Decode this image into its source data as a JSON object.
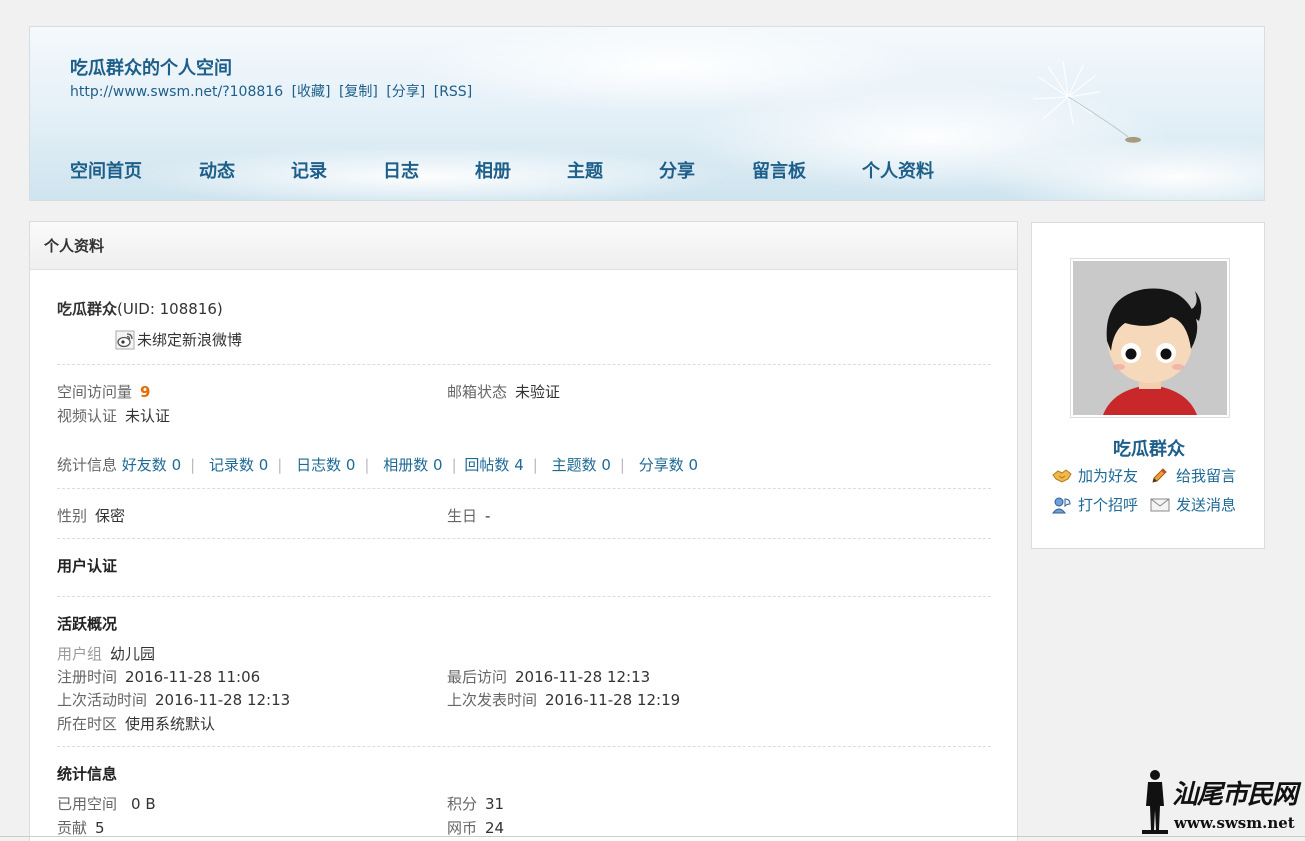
{
  "header": {
    "title": "吃瓜群众的个人空间",
    "url": "http://www.swsm.net/?108816",
    "url_links": [
      "[收藏]",
      "[复制]",
      "[分享]",
      "[RSS]"
    ],
    "nav": [
      "空间首页",
      "动态",
      "记录",
      "日志",
      "相册",
      "主题",
      "分享",
      "留言板",
      "个人资料"
    ]
  },
  "panel": {
    "title": "个人资料",
    "username": "吃瓜群众",
    "uid": "(UID: 108816)",
    "weibo": "未绑定新浪微博",
    "visits_label": "空间访问量",
    "visits_value": "9",
    "email_label": "邮箱状态",
    "email_value": "未验证",
    "video_label": "视频认证",
    "video_value": "未认证",
    "stats_label": "统计信息",
    "stats": [
      "好友数 0",
      "记录数 0",
      "日志数 0",
      "相册数 0",
      "回帖数 4",
      "主题数 0",
      "分享数 0"
    ],
    "gender_label": "性别",
    "gender_value": "保密",
    "birthday_label": "生日",
    "birthday_value": "-",
    "auth_title": "用户认证",
    "active_title": "活跃概况",
    "group_label": "用户组",
    "group_value": "幼儿园",
    "reg_label": "注册时间",
    "reg_value": "2016-11-28 11:06",
    "last_visit_label": "最后访问",
    "last_visit_value": "2016-11-28 12:13",
    "last_active_label": "上次活动时间",
    "last_active_value": "2016-11-28 12:13",
    "last_post_label": "上次发表时间",
    "last_post_value": "2016-11-28 12:19",
    "tz_label": "所在时区",
    "tz_value": "使用系统默认",
    "stat_title": "统计信息",
    "space_label": "已用空间",
    "space_value": "0 B",
    "points_label": "积分",
    "points_value": "31",
    "contrib_label": "贡献",
    "contrib_value": "5",
    "coin_label": "网币",
    "coin_value": "24"
  },
  "side": {
    "name": "吃瓜群众",
    "add_friend": "加为好友",
    "leave_message": "给我留言",
    "greet": "打个招呼",
    "send_message": "发送消息"
  },
  "watermark": {
    "text": "汕尾市民网",
    "domain": "www.swsm.net"
  },
  "icons": {
    "weibo": "weibo-icon",
    "add_friend": "handshake-icon",
    "leave_message": "pencil-icon",
    "greet": "user-wave-icon",
    "send_message": "envelope-icon"
  }
}
